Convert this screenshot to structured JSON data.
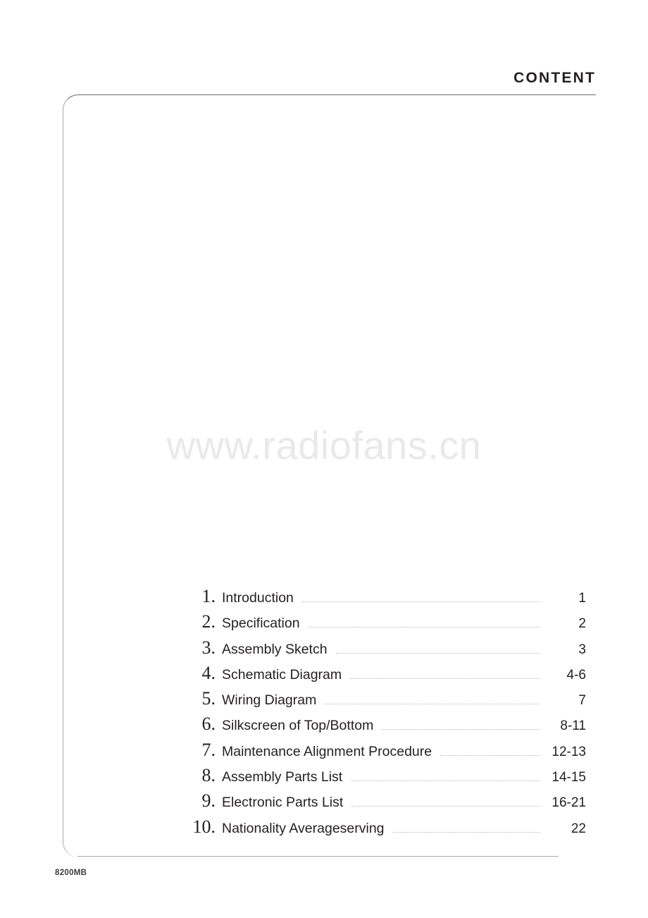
{
  "header": {
    "title": "CONTENT"
  },
  "watermark": {
    "text": "www.radiofans.cn"
  },
  "footer": {
    "code": "8200MB"
  },
  "colors": {
    "text": "#231f20",
    "rule": "#6d6d6d",
    "frame": "#a7a7a7",
    "leader": "#b9b9b9",
    "watermark": "#e9e9e9"
  },
  "toc": {
    "items": [
      {
        "number": "1.",
        "label": "Introduction",
        "page": "1"
      },
      {
        "number": "2.",
        "label": "Specification",
        "page": "2"
      },
      {
        "number": "3.",
        "label": "Assembly Sketch",
        "page": "3"
      },
      {
        "number": "4.",
        "label": "Schematic Diagram",
        "page": "4-6"
      },
      {
        "number": "5.",
        "label": "Wiring Diagram",
        "page": "7"
      },
      {
        "number": "6.",
        "label": "Silkscreen of Top/Bottom",
        "page": "8-11"
      },
      {
        "number": "7.",
        "label": "Maintenance Alignment Procedure",
        "page": "12-13"
      },
      {
        "number": "8.",
        "label": "Assembly Parts List",
        "page": "14-15"
      },
      {
        "number": "9.",
        "label": "Electronic Parts List",
        "page": "16-21"
      },
      {
        "number": "10.",
        "label": "Nationality Averageserving",
        "page": "22"
      }
    ]
  }
}
